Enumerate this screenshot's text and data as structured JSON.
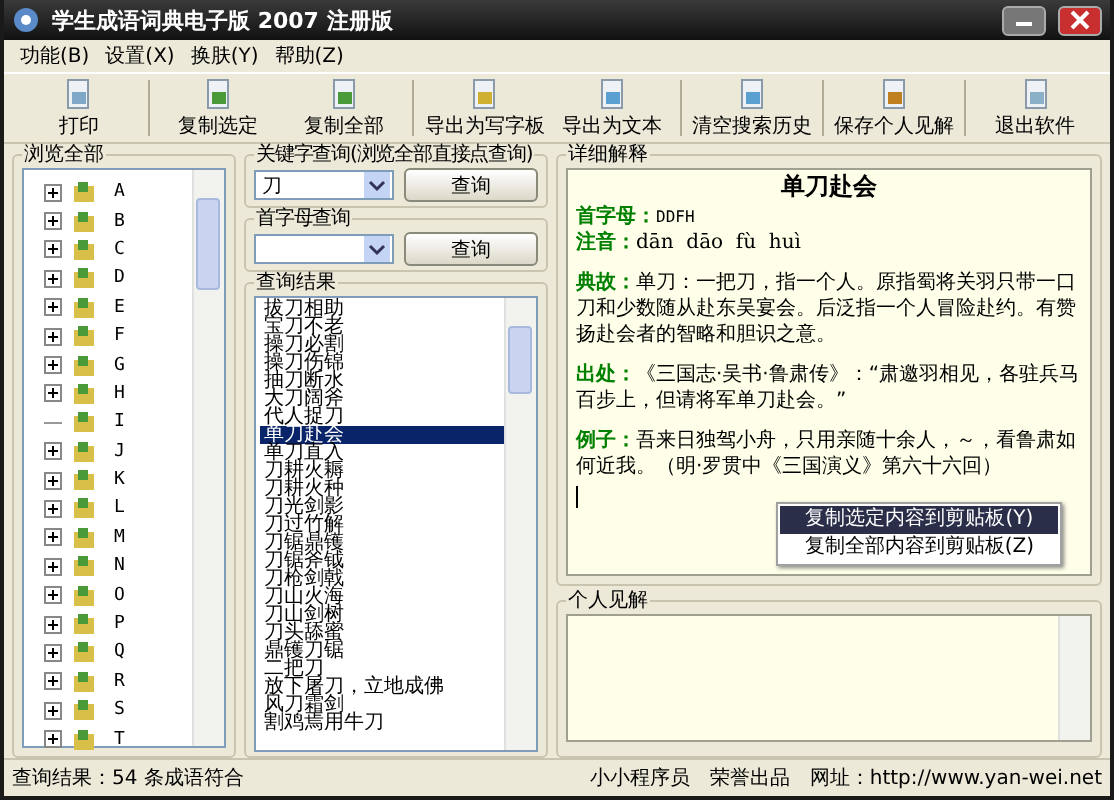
{
  "window": {
    "title": "学生成语词典电子版 2007 注册版"
  },
  "menu": [
    "功能(B)",
    "设置(X)",
    "换肤(Y)",
    "帮助(Z)"
  ],
  "toolbar": [
    {
      "label": "打印",
      "separator_before": false
    },
    {
      "label": "复制选定",
      "separator_before": true
    },
    {
      "label": "复制全部",
      "separator_before": false
    },
    {
      "label": "导出为写字板",
      "separator_before": true
    },
    {
      "label": "导出为文本",
      "separator_before": false
    },
    {
      "label": "清空搜索历史",
      "separator_before": true
    },
    {
      "label": "保存个人见解",
      "separator_before": true
    },
    {
      "label": "退出软件",
      "separator_before": true
    }
  ],
  "browse": {
    "title": "浏览全部",
    "items": [
      {
        "label": "A",
        "has_children": true
      },
      {
        "label": "B",
        "has_children": true
      },
      {
        "label": "C",
        "has_children": true
      },
      {
        "label": "D",
        "has_children": true
      },
      {
        "label": "E",
        "has_children": true
      },
      {
        "label": "F",
        "has_children": true
      },
      {
        "label": "G",
        "has_children": true
      },
      {
        "label": "H",
        "has_children": true
      },
      {
        "label": "I",
        "has_children": false
      },
      {
        "label": "J",
        "has_children": true
      },
      {
        "label": "K",
        "has_children": true
      },
      {
        "label": "L",
        "has_children": true
      },
      {
        "label": "M",
        "has_children": true
      },
      {
        "label": "N",
        "has_children": true
      },
      {
        "label": "O",
        "has_children": true
      },
      {
        "label": "P",
        "has_children": true
      },
      {
        "label": "Q",
        "has_children": true
      },
      {
        "label": "R",
        "has_children": true
      },
      {
        "label": "S",
        "has_children": true
      },
      {
        "label": "T",
        "has_children": true
      }
    ]
  },
  "keyword_search": {
    "title": "关键字查询(浏览全部直接点查询)",
    "value": "刀",
    "button": "查询"
  },
  "initial_search": {
    "title": "首字母查询",
    "button": "查询"
  },
  "results": {
    "title": "查询结果",
    "items": [
      {
        "label": "拔刀相助",
        "selected": false
      },
      {
        "label": "宝刀不老",
        "selected": false
      },
      {
        "label": "操刀必割",
        "selected": false
      },
      {
        "label": "操刀伤锦",
        "selected": false
      },
      {
        "label": "抽刀断水",
        "selected": false
      },
      {
        "label": "大刀阔斧",
        "selected": false
      },
      {
        "label": "代人捉刀",
        "selected": false
      },
      {
        "label": "单刀赴会",
        "selected": true
      },
      {
        "label": "单刀直入",
        "selected": false
      },
      {
        "label": "刀耕火耨",
        "selected": false
      },
      {
        "label": "刀耕火种",
        "selected": false
      },
      {
        "label": "刀光剑影",
        "selected": false
      },
      {
        "label": "刀过竹解",
        "selected": false
      },
      {
        "label": "刀锯鼎镬",
        "selected": false
      },
      {
        "label": "刀锯斧钺",
        "selected": false
      },
      {
        "label": "刀枪剑戟",
        "selected": false
      },
      {
        "label": "刀山火海",
        "selected": false
      },
      {
        "label": "刀山剑树",
        "selected": false
      },
      {
        "label": "刀头舔蜜",
        "selected": false
      },
      {
        "label": "鼎镬刀锯",
        "selected": false
      },
      {
        "label": "二把刀",
        "selected": false
      },
      {
        "label": "放下屠刀，立地成佛",
        "selected": false
      },
      {
        "label": "风刀霜剑",
        "selected": false
      },
      {
        "label": "割鸡焉用牛刀",
        "selected": false
      }
    ]
  },
  "detail": {
    "title": "详细解释",
    "heading": "单刀赴会",
    "fields": [
      {
        "label": "首字母：",
        "value": "DDFH",
        "kind": "code"
      },
      {
        "label": "注音：",
        "value": "dān  dāo  fù  huì",
        "kind": "pinyin"
      },
      {
        "label": "典故：",
        "value": "单刀：一把刀，指一个人。原指蜀将关羽只带一口刀和少数随从赴东吴宴会。后泛指一个人冒险赴约。有赞扬赴会者的智略和胆识之意。",
        "kind": "para"
      },
      {
        "label": "出处：",
        "value": "《三国志·吴书·鲁肃传》：“肃邀羽相见，各驻兵马百步上，但请将军单刀赴会。”",
        "kind": "para"
      },
      {
        "label": "例子：",
        "value": "吾来日独驾小舟，只用亲随十余人，～，看鲁肃如何近我。（明·罗贯中《三国演义》第六十六回）",
        "kind": "para"
      }
    ]
  },
  "context_menu": [
    {
      "label": "复制选定内容到剪贴板(Y)",
      "selected": true
    },
    {
      "label": "复制全部内容到剪贴板(Z)",
      "selected": false
    }
  ],
  "opinion": {
    "title": "个人见解"
  },
  "status_bar": {
    "result": "查询结果：54 条成语符合",
    "author": "小小程序员",
    "credit": "荣誉出品",
    "url_label": "网址：http://www.yan-wei.net"
  }
}
